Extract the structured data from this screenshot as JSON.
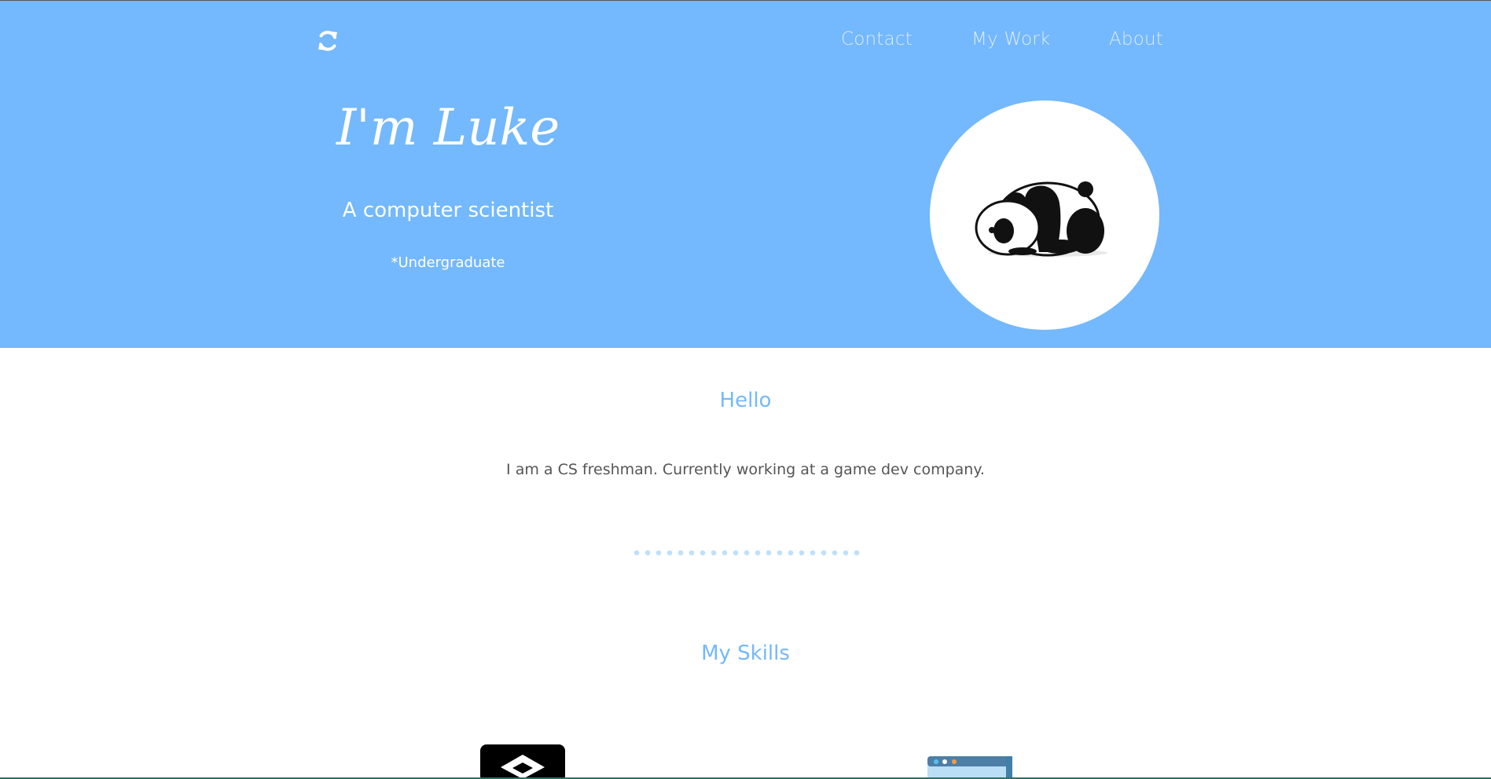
{
  "header": {
    "logo_icon": "refresh-icon",
    "nav": [
      {
        "label": "Contact"
      },
      {
        "label": "My Work"
      },
      {
        "label": "About"
      }
    ]
  },
  "hero": {
    "name": "I'm Luke",
    "subtitle": "A computer scientist",
    "note": "*Undergraduate",
    "avatar_icon": "sleeping-panda-image",
    "background_color": "#74b8fd"
  },
  "hello": {
    "title": "Hello",
    "text": "I am a CS freshman. Currently working at a game dev company."
  },
  "skills": {
    "title": "My Skills",
    "items": [
      {
        "icon": "cube-code-icon"
      },
      {
        "icon": "browser-window-icon"
      }
    ]
  },
  "colors": {
    "accent": "#74b8fd",
    "text": "#555555",
    "divider_dots": "#bfe0fb"
  }
}
